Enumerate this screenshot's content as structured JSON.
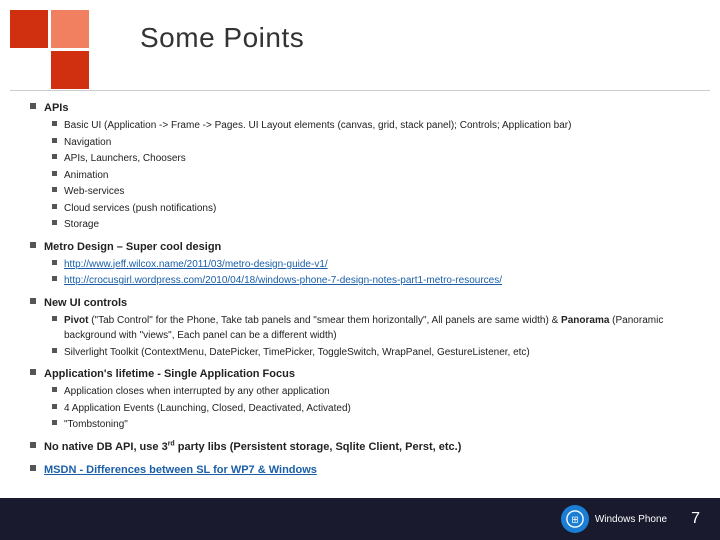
{
  "slide": {
    "title": "Some Points",
    "logo": {
      "cells": [
        "medium",
        "light",
        "empty",
        "medium"
      ]
    },
    "sections": [
      {
        "id": "apis",
        "label": "APIs",
        "subitems": [
          {
            "id": "basic-ui",
            "text": "Basic UI  (Application -> Frame -> Pages. UI Layout elements (canvas, grid, stack panel);  Controls; Application bar)",
            "link": false
          },
          {
            "id": "navigation",
            "text": "Navigation",
            "link": false
          },
          {
            "id": "apis-launchers",
            "text": "APIs, Launchers, Choosers",
            "link": false
          },
          {
            "id": "animation",
            "text": "Animation",
            "link": false
          },
          {
            "id": "web-services",
            "text": "Web-services",
            "link": false
          },
          {
            "id": "cloud-services",
            "text": "Cloud services (push notifications)",
            "link": false
          },
          {
            "id": "storage",
            "text": "Storage",
            "link": false
          }
        ]
      },
      {
        "id": "metro-design",
        "label": "Metro Design – Super cool design",
        "subitems": [
          {
            "id": "metro-link1",
            "text": "http://www.jeff.wilcox.name/2011/03/metro-design-guide-v1/",
            "link": true
          },
          {
            "id": "metro-link2",
            "text": "http://crocusgirl.wordpress.com/2010/04/18/windows-phone-7-design-notes-part1-metro-resources/",
            "link": true
          }
        ]
      },
      {
        "id": "new-ui-controls",
        "label": "New UI controls",
        "subitems": [
          {
            "id": "pivot",
            "text": "Pivot  (\"Tab Control\" for the Phone, Take tab panels and \"smear them horizontally\", All panels are same width) & Panorama (Panoramic background with \"views\", Each panel can be a different width)",
            "link": false,
            "bold_prefix": "Pivot"
          },
          {
            "id": "silverlight",
            "text": "Silverlight Toolkit (ContextMenu, DatePicker, TimePicker, ToggleSwitch, WrapPanel, GestureListener, etc)",
            "link": false
          }
        ]
      },
      {
        "id": "app-lifetime",
        "label": "Application's lifetime - Single Application Focus",
        "subitems": [
          {
            "id": "app-interrupted",
            "text": "Application closes when interrupted by any other application",
            "link": false
          },
          {
            "id": "app-events",
            "text": "4 Application Events (Launching, Closed, Deactivated, Activated)",
            "link": false
          },
          {
            "id": "tombstoning",
            "text": "\"Tombstoning\"",
            "link": false
          }
        ]
      },
      {
        "id": "no-db",
        "label": "No native DB API, use 3rd party libs (Persistent storage, Sqlite Client, Perst, etc.)",
        "subitems": []
      },
      {
        "id": "msdn",
        "label": "MSDN - Differences between SL for WP7 & Windows",
        "subitems": [],
        "link": true
      }
    ],
    "footer": {
      "wp_label_line1": "Windows Phone",
      "page_number": "7"
    }
  }
}
